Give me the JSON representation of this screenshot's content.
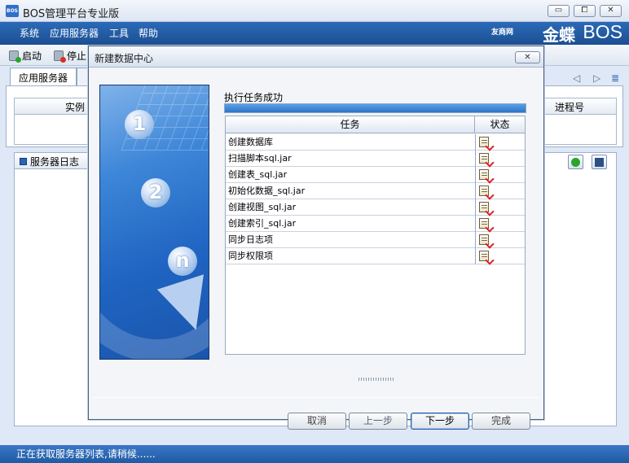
{
  "window": {
    "title": "BOS管理平台专业版",
    "logo": "BOS",
    "min": "▭",
    "max": "⧠",
    "close": "✕"
  },
  "menu": {
    "items": [
      "系统",
      "应用服务器",
      "工具",
      "帮助"
    ],
    "brand_yy": "友商网",
    "brand_jd": "金蝶",
    "brand_bos": "BOS"
  },
  "toolbar": {
    "start": "启动",
    "stop": "停止"
  },
  "tabs": {
    "active": "应用服务器"
  },
  "grid": {
    "col_instance": "实例",
    "col_pid": "进程号"
  },
  "log": {
    "title": "服务器日志"
  },
  "status": {
    "text": "正在获取服务器列表,请稍候......"
  },
  "dialog": {
    "title": "新建数据中心",
    "close": "✕",
    "message": "执行任务成功",
    "progress": 1.0,
    "table_headers": {
      "task": "任务",
      "status": "状态"
    },
    "tasks": [
      "创建数据库",
      "扫描脚本sql.jar",
      "创建表_sql.jar",
      "初始化数据_sql.jar",
      "创建视图_sql.jar",
      "创建索引_sql.jar",
      "同步日志项",
      "同步权限项"
    ],
    "art_numbers": [
      "1",
      "2",
      "n"
    ],
    "buttons": {
      "cancel": "取消",
      "prev": "上一步",
      "next": "下一步",
      "finish": "完成"
    }
  }
}
